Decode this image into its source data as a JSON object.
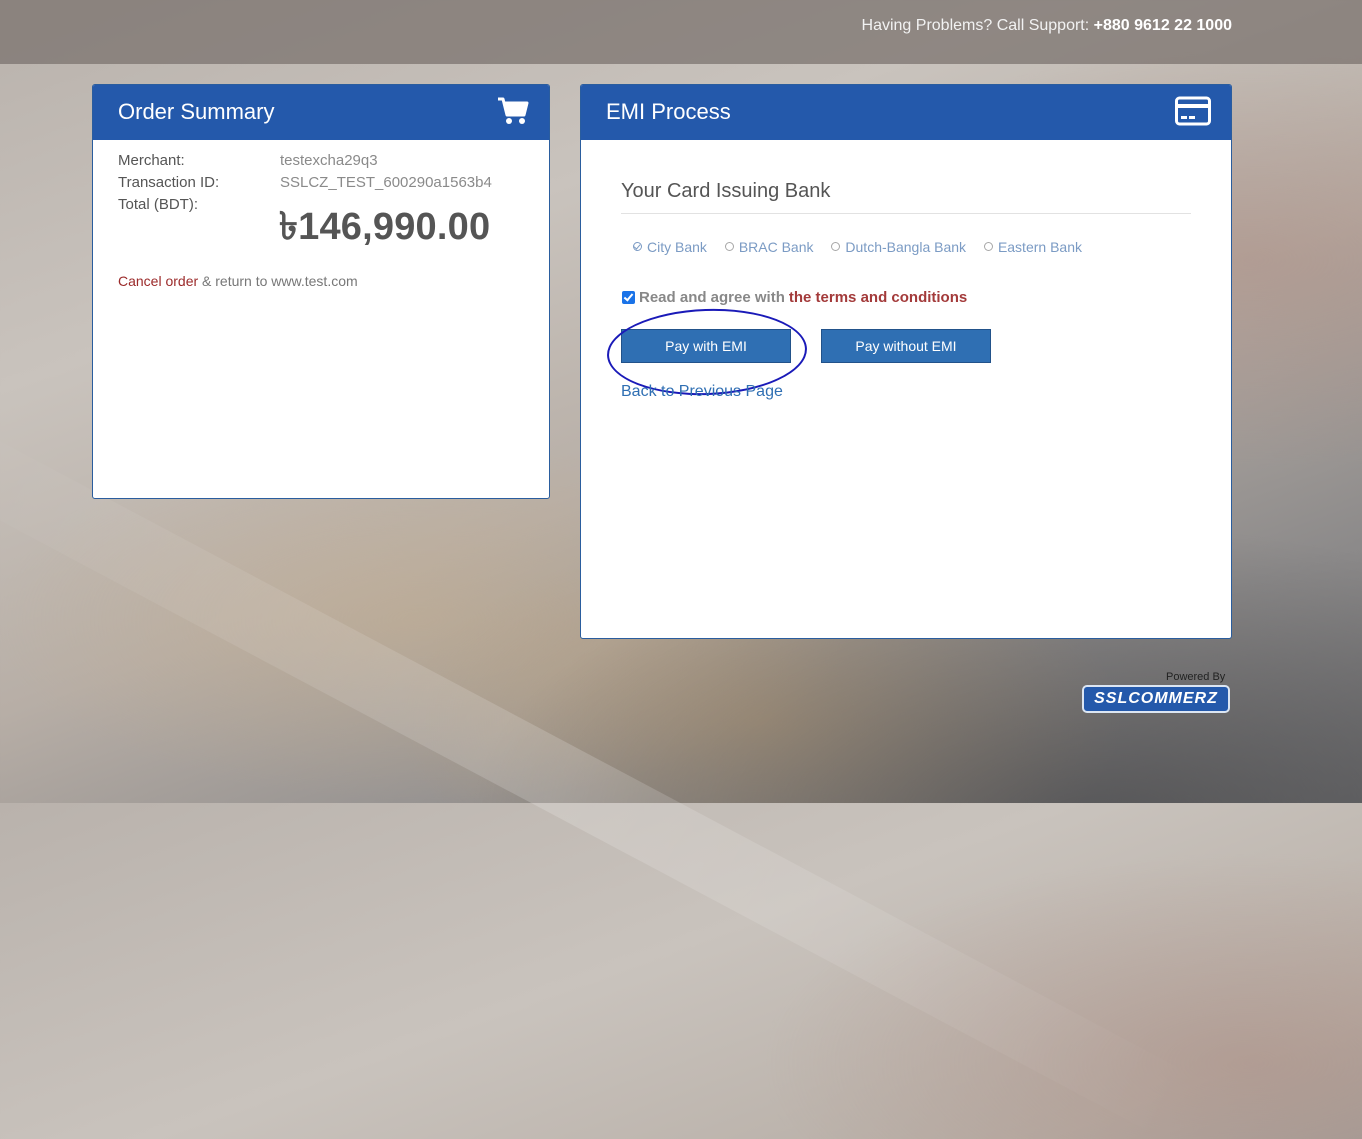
{
  "header": {
    "support_text": "Having Problems? Call Support:",
    "support_phone": "+880 9612 22 1000"
  },
  "order_summary": {
    "title": "Order Summary",
    "icon": "cart-icon",
    "merchant_label": "Merchant:",
    "merchant_value": "testexcha29q3",
    "transaction_label": "Transaction ID:",
    "transaction_value": "SSLCZ_TEST_600290a1563b4",
    "total_label": "Total (BDT):",
    "total_value": "৳146,990.00",
    "cancel_link": "Cancel order",
    "cancel_suffix": " & return to www.test.com"
  },
  "emi": {
    "title": "EMI Process",
    "icon": "credit-card-icon",
    "bank_heading": "Your Card Issuing Bank",
    "banks": [
      {
        "label": "City Bank",
        "selected": true
      },
      {
        "label": "BRAC Bank",
        "selected": false
      },
      {
        "label": "Dutch-Bangla Bank",
        "selected": false
      },
      {
        "label": "Eastern Bank",
        "selected": false
      }
    ],
    "agree_text": "Read and agree with",
    "terms_link": "the terms and conditions",
    "agree_checked": true,
    "pay_emi_label": "Pay with EMI",
    "pay_no_emi_label": "Pay without EMI",
    "back_link": "Back to Previous Page"
  },
  "footer": {
    "powered_by": "Powered By",
    "logo_text": "SSLCOMMERZ"
  }
}
